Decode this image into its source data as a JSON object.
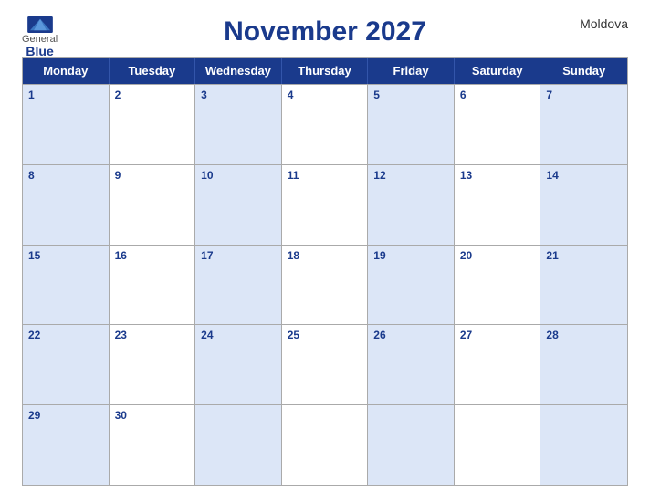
{
  "header": {
    "title": "November 2027",
    "country": "Moldova",
    "logo": {
      "general": "General",
      "blue": "Blue"
    }
  },
  "days": [
    "Monday",
    "Tuesday",
    "Wednesday",
    "Thursday",
    "Friday",
    "Saturday",
    "Sunday"
  ],
  "weeks": [
    [
      {
        "num": "1",
        "shaded": true
      },
      {
        "num": "2",
        "shaded": false
      },
      {
        "num": "3",
        "shaded": true
      },
      {
        "num": "4",
        "shaded": false
      },
      {
        "num": "5",
        "shaded": true
      },
      {
        "num": "6",
        "shaded": false
      },
      {
        "num": "7",
        "shaded": true
      }
    ],
    [
      {
        "num": "8",
        "shaded": true
      },
      {
        "num": "9",
        "shaded": false
      },
      {
        "num": "10",
        "shaded": true
      },
      {
        "num": "11",
        "shaded": false
      },
      {
        "num": "12",
        "shaded": true
      },
      {
        "num": "13",
        "shaded": false
      },
      {
        "num": "14",
        "shaded": true
      }
    ],
    [
      {
        "num": "15",
        "shaded": true
      },
      {
        "num": "16",
        "shaded": false
      },
      {
        "num": "17",
        "shaded": true
      },
      {
        "num": "18",
        "shaded": false
      },
      {
        "num": "19",
        "shaded": true
      },
      {
        "num": "20",
        "shaded": false
      },
      {
        "num": "21",
        "shaded": true
      }
    ],
    [
      {
        "num": "22",
        "shaded": true
      },
      {
        "num": "23",
        "shaded": false
      },
      {
        "num": "24",
        "shaded": true
      },
      {
        "num": "25",
        "shaded": false
      },
      {
        "num": "26",
        "shaded": true
      },
      {
        "num": "27",
        "shaded": false
      },
      {
        "num": "28",
        "shaded": true
      }
    ],
    [
      {
        "num": "29",
        "shaded": true
      },
      {
        "num": "30",
        "shaded": false
      },
      {
        "num": "",
        "shaded": true
      },
      {
        "num": "",
        "shaded": false
      },
      {
        "num": "",
        "shaded": true
      },
      {
        "num": "",
        "shaded": false
      },
      {
        "num": "",
        "shaded": true
      }
    ]
  ]
}
